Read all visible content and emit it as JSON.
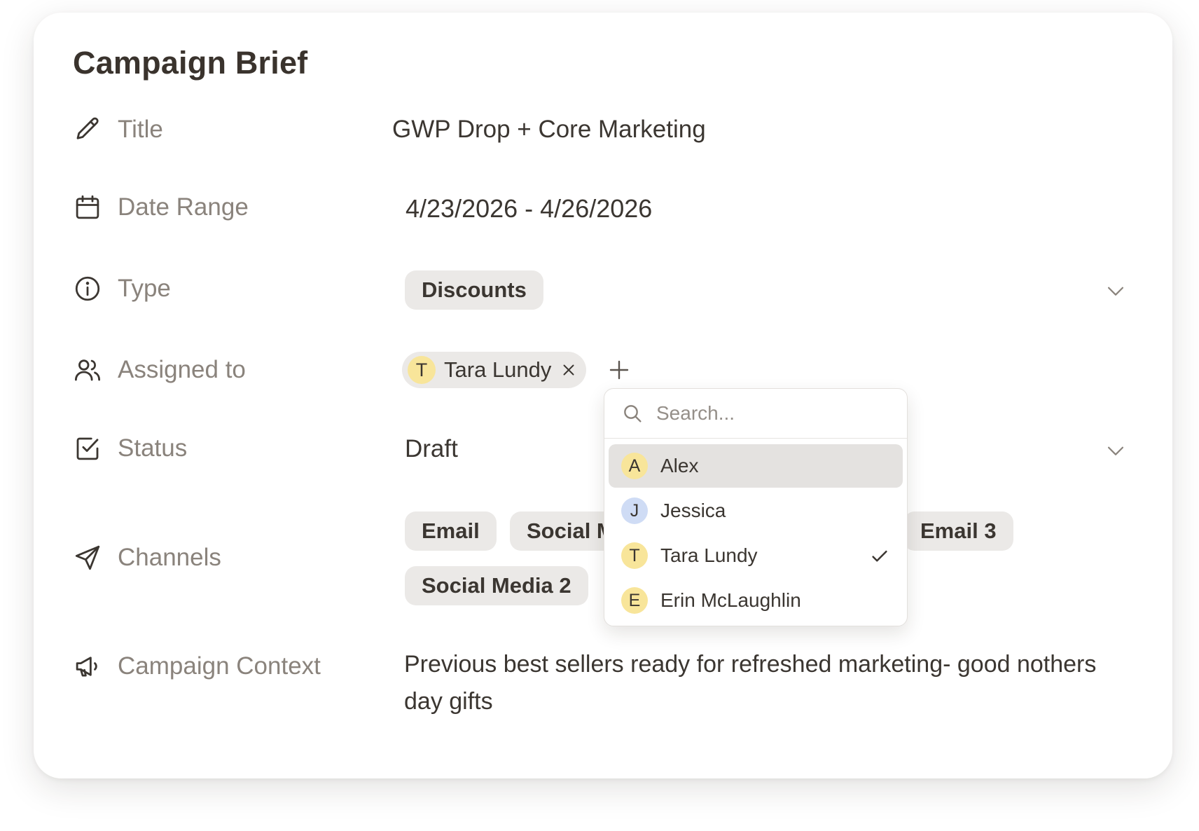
{
  "card": {
    "title": "Campaign Brief"
  },
  "fields": {
    "title": {
      "label": "Title",
      "value": "GWP Drop + Core Marketing"
    },
    "date_range": {
      "label": "Date Range",
      "value": "4/23/2026 - 4/26/2026"
    },
    "type": {
      "label": "Type",
      "value": "Discounts"
    },
    "assigned_to": {
      "label": "Assigned to",
      "assignee": {
        "initial": "T",
        "name": "Tara Lundy"
      }
    },
    "status": {
      "label": "Status",
      "value": "Draft"
    },
    "channels": {
      "label": "Channels",
      "items": [
        "Email",
        "Social M",
        "Email 3",
        "Social Media 2"
      ]
    },
    "campaign_context": {
      "label": "Campaign Context",
      "value": "Previous best sellers ready for refreshed marketing- good nothers day gifts"
    }
  },
  "dropdown": {
    "search_placeholder": "Search...",
    "options": [
      {
        "initial": "A",
        "name": "Alex",
        "avatar_color": "#f8e59a",
        "highlighted": true,
        "selected": false
      },
      {
        "initial": "J",
        "name": "Jessica",
        "avatar_color": "#cfdcf5",
        "highlighted": false,
        "selected": false
      },
      {
        "initial": "T",
        "name": "Tara Lundy",
        "avatar_color": "#f8e59a",
        "highlighted": false,
        "selected": true
      },
      {
        "initial": "E",
        "name": "Erin McLaughlin",
        "avatar_color": "#f8e59a",
        "highlighted": false,
        "selected": false
      }
    ]
  },
  "icons": {
    "title": "pencil-icon",
    "date_range": "calendar-icon",
    "type": "info-icon",
    "assigned_to": "users-icon",
    "status": "checkbox-icon",
    "channels": "send-icon",
    "campaign_context": "megaphone-icon"
  },
  "colors": {
    "chip_bg": "#ebe9e7",
    "label": "#8a837c",
    "text": "#3b3631",
    "avatar_yellow": "#f8e59a",
    "avatar_blue": "#cfdcf5",
    "highlight": "#e4e2e0"
  }
}
